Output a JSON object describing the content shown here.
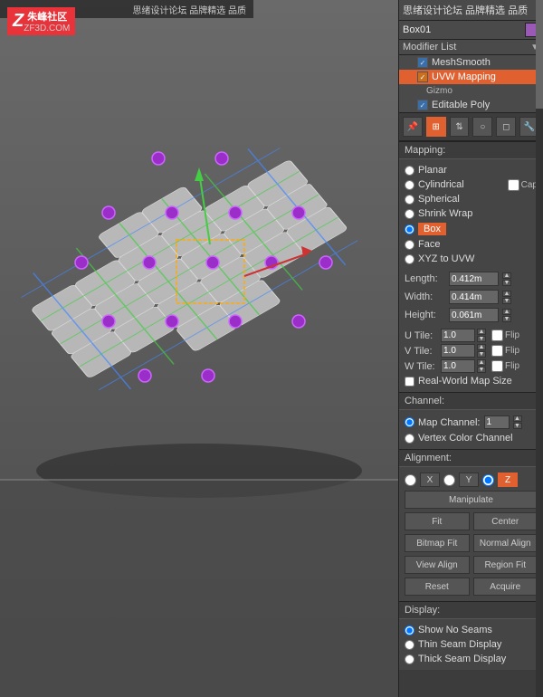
{
  "logo": {
    "z": "Z",
    "line1": "朱峰社区",
    "line2": "ZF3D.COM"
  },
  "topbar": {
    "text": "思绪设计论坛 品牌精选 品质"
  },
  "panel": {
    "object_name": "Box01",
    "color_swatch": "#9b59b6",
    "modifier_list_label": "Modifier List",
    "modifiers": [
      {
        "label": "MeshSmooth",
        "type": "mesh",
        "active": false
      },
      {
        "label": "UVW Mapping",
        "type": "uvw",
        "active": true
      },
      {
        "label": "Gizmo",
        "type": "sub",
        "active": false
      },
      {
        "label": "Editable Poly",
        "type": "poly",
        "active": false
      }
    ]
  },
  "mapping": {
    "section_label": "Mapping:",
    "options": [
      {
        "id": "planar",
        "label": "Planar",
        "checked": false
      },
      {
        "id": "cylindrical",
        "label": "Cylindrical",
        "checked": false
      },
      {
        "id": "cap",
        "label": "Cap",
        "checked": false
      },
      {
        "id": "spherical",
        "label": "Spherical",
        "checked": false
      },
      {
        "id": "shrinkwrap",
        "label": "Shrink Wrap",
        "checked": false
      },
      {
        "id": "box",
        "label": "Box",
        "checked": true
      },
      {
        "id": "face",
        "label": "Face",
        "checked": false
      },
      {
        "id": "xyz",
        "label": "XYZ to UVW",
        "checked": false
      }
    ],
    "length_label": "Length:",
    "length_value": "0.412m",
    "width_label": "Width:",
    "width_value": "0.414m",
    "height_label": "Height:",
    "height_value": "0.061m",
    "utile_label": "U Tile:",
    "utile_value": "1.0",
    "vtile_label": "V Tile:",
    "vtile_value": "1.0",
    "wtile_label": "W Tile:",
    "wtile_value": "1.0",
    "flip_label": "Flip",
    "realworld_label": "Real-World Map Size"
  },
  "channel": {
    "section_label": "Channel:",
    "map_channel_label": "Map Channel:",
    "map_channel_value": "1",
    "vertex_color_label": "Vertex Color Channel"
  },
  "alignment": {
    "section_label": "Alignment:",
    "x_label": "X",
    "y_label": "Y",
    "z_label": "Z",
    "manipulate_label": "Manipulate",
    "fit_label": "Fit",
    "center_label": "Center",
    "bitmap_fit_label": "Bitmap Fit",
    "normal_align_label": "Normal Align",
    "view_align_label": "View Align",
    "region_fit_label": "Region Fit",
    "reset_label": "Reset",
    "acquire_label": "Acquire"
  },
  "display": {
    "section_label": "Display:",
    "show_no_seams": "Show No Seams",
    "thin_seam": "Thin Seam Display",
    "thick_seam": "Thick Seam Display"
  }
}
